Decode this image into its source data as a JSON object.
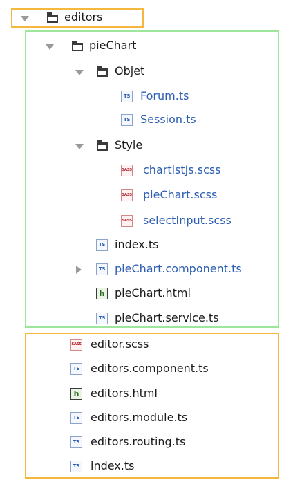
{
  "tree": {
    "root": {
      "label": "editors",
      "expanded": true
    },
    "pieChart": {
      "label": "pieChart",
      "expanded": true,
      "objet": {
        "label": "Objet",
        "expanded": true,
        "files": [
          "Forum.ts",
          "Session.ts"
        ]
      },
      "style": {
        "label": "Style",
        "expanded": true,
        "files": [
          "chartistJs.scss",
          "pieChart.scss",
          "selectInput.scss"
        ]
      },
      "files": [
        "index.ts",
        "pieChart.component.ts",
        "pieChart.html",
        "pieChart.service.ts"
      ]
    },
    "files": [
      "editor.scss",
      "editors.component.ts",
      "editors.html",
      "editors.module.ts",
      "editors.routing.ts",
      "index.ts"
    ]
  },
  "icons": {
    "ts": "TS",
    "sass": "SASS",
    "html": "h"
  },
  "colors": {
    "highlight_orange": "#f5b83e",
    "highlight_green": "#9ee69c",
    "link_blue": "#2d5eb3",
    "sass_red": "#b2202b"
  }
}
